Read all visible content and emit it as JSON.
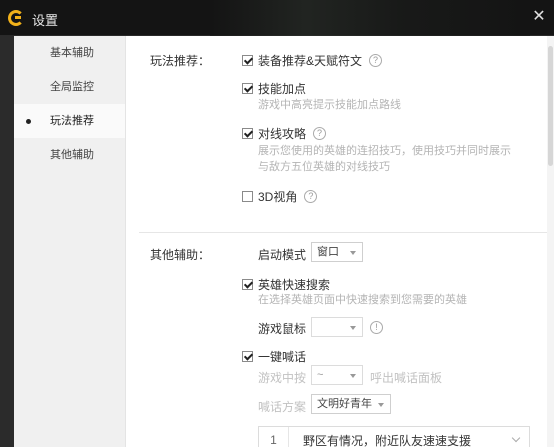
{
  "window": {
    "title": "设置",
    "close_symbol": "✕"
  },
  "sidebar": {
    "items": [
      {
        "label": "基本辅助",
        "active": false
      },
      {
        "label": "全局监控",
        "active": false
      },
      {
        "label": "玩法推荐",
        "active": true
      },
      {
        "label": "其他辅助",
        "active": false
      }
    ]
  },
  "gameplay": {
    "section_label": "玩法推荐：",
    "items": [
      {
        "label": "装备推荐&天赋符文",
        "checked": true,
        "help": "?"
      },
      {
        "label": "技能加点",
        "checked": true,
        "desc": "游戏中高亮提示技能加点路线"
      },
      {
        "label": "对线攻略",
        "checked": true,
        "help": "?",
        "desc_line1": "展示您使用的英雄的连招技巧，使用技巧并同时展示",
        "desc_line2": "与敌方五位英雄的对线技巧"
      },
      {
        "label": "3D视角",
        "checked": false,
        "help": "?"
      }
    ]
  },
  "other": {
    "section_label": "其他辅助：",
    "launch_mode_label": "启动模式",
    "launch_mode_value": "窗口",
    "hero_search": {
      "label": "英雄快速搜索",
      "checked": true,
      "desc": "在选择英雄页面中快速搜索到您需要的英雄"
    },
    "mouse_label": "游戏鼠标",
    "mouse_value": "",
    "info_symbol": "!",
    "quick_shout": {
      "label": "一键喊话",
      "checked": true
    },
    "hotkey_label": "游戏中按",
    "hotkey_value": "~",
    "hotkey_suffix": "呼出喊话面板",
    "scheme_label": "喊话方案",
    "scheme_value": "文明好青年",
    "message": {
      "index": "1",
      "text": "野区有情况，附近队友速速支援"
    }
  },
  "colors": {
    "titlebar": "#141414",
    "logo": "#f2b21a",
    "sidebar": "#f0f0f0",
    "hint_text": "#b4b4b4"
  }
}
